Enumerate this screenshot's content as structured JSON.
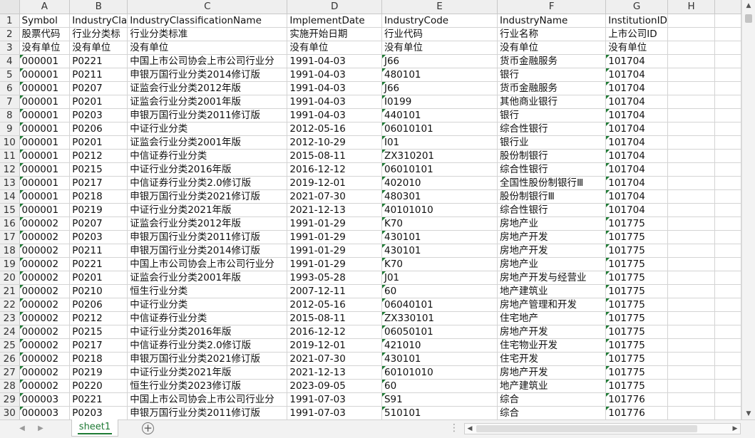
{
  "columns": [
    "A",
    "B",
    "C",
    "D",
    "E",
    "F",
    "G",
    "H"
  ],
  "rows": [
    [
      "Symbol",
      "IndustryCla",
      "IndustryClassificationName",
      "ImplementDate",
      "IndustryCode",
      "IndustryName",
      "InstitutionID",
      ""
    ],
    [
      "股票代码",
      "行业分类标",
      "行业分类标准",
      "实施开始日期",
      "行业代码",
      "行业名称",
      "上市公司ID",
      ""
    ],
    [
      "没有单位",
      "没有单位",
      "没有单位",
      "没有单位",
      "没有单位",
      "没有单位",
      "没有单位",
      ""
    ],
    [
      "000001",
      "P0221",
      "中国上市公司协会上市公司行业分",
      "1991-04-03",
      "J66",
      "货币金融服务",
      "101704",
      ""
    ],
    [
      "000001",
      "P0211",
      "申银万国行业分类2014修订版",
      "1991-04-03",
      "480101",
      "银行",
      "101704",
      ""
    ],
    [
      "000001",
      "P0207",
      "证监会行业分类2012年版",
      "1991-04-03",
      "J66",
      "货币金融服务",
      "101704",
      ""
    ],
    [
      "000001",
      "P0201",
      "证监会行业分类2001年版",
      "1991-04-03",
      "I0199",
      "其他商业银行",
      "101704",
      ""
    ],
    [
      "000001",
      "P0203",
      "申银万国行业分类2011修订版",
      "1991-04-03",
      "440101",
      "银行",
      "101704",
      ""
    ],
    [
      "000001",
      "P0206",
      "中证行业分类",
      "2012-05-16",
      "06010101",
      "综合性银行",
      "101704",
      ""
    ],
    [
      "000001",
      "P0201",
      "证监会行业分类2001年版",
      "2012-10-29",
      "I01",
      "银行业",
      "101704",
      ""
    ],
    [
      "000001",
      "P0212",
      "中信证券行业分类",
      "2015-08-11",
      "ZX310201",
      "股份制银行",
      "101704",
      ""
    ],
    [
      "000001",
      "P0215",
      "中证行业分类2016年版",
      "2016-12-12",
      "06010101",
      "综合性银行",
      "101704",
      ""
    ],
    [
      "000001",
      "P0217",
      "中信证券行业分类2.0修订版",
      "2019-12-01",
      "402010",
      "全国性股份制银行Ⅲ",
      "101704",
      ""
    ],
    [
      "000001",
      "P0218",
      "申银万国行业分类2021修订版",
      "2021-07-30",
      "480301",
      "股份制银行Ⅲ",
      "101704",
      ""
    ],
    [
      "000001",
      "P0219",
      "中证行业分类2021年版",
      "2021-12-13",
      "40101010",
      "综合性银行",
      "101704",
      ""
    ],
    [
      "000002",
      "P0207",
      "证监会行业分类2012年版",
      "1991-01-29",
      "K70",
      "房地产业",
      "101775",
      ""
    ],
    [
      "000002",
      "P0203",
      "申银万国行业分类2011修订版",
      "1991-01-29",
      "430101",
      "房地产开发",
      "101775",
      ""
    ],
    [
      "000002",
      "P0211",
      "申银万国行业分类2014修订版",
      "1991-01-29",
      "430101",
      "房地产开发",
      "101775",
      ""
    ],
    [
      "000002",
      "P0221",
      "中国上市公司协会上市公司行业分",
      "1991-01-29",
      "K70",
      "房地产业",
      "101775",
      ""
    ],
    [
      "000002",
      "P0201",
      "证监会行业分类2001年版",
      "1993-05-28",
      "J01",
      "房地产开发与经营业",
      "101775",
      ""
    ],
    [
      "000002",
      "P0210",
      "恒生行业分类",
      "2007-12-11",
      "60",
      "地产建筑业",
      "101775",
      ""
    ],
    [
      "000002",
      "P0206",
      "中证行业分类",
      "2012-05-16",
      "06040101",
      "房地产管理和开发",
      "101775",
      ""
    ],
    [
      "000002",
      "P0212",
      "中信证券行业分类",
      "2015-08-11",
      "ZX330101",
      "住宅地产",
      "101775",
      ""
    ],
    [
      "000002",
      "P0215",
      "中证行业分类2016年版",
      "2016-12-12",
      "06050101",
      "房地产开发",
      "101775",
      ""
    ],
    [
      "000002",
      "P0217",
      "中信证券行业分类2.0修订版",
      "2019-12-01",
      "421010",
      "住宅物业开发",
      "101775",
      ""
    ],
    [
      "000002",
      "P0218",
      "申银万国行业分类2021修订版",
      "2021-07-30",
      "430101",
      "住宅开发",
      "101775",
      ""
    ],
    [
      "000002",
      "P0219",
      "中证行业分类2021年版",
      "2021-12-13",
      "60101010",
      "房地产开发",
      "101775",
      ""
    ],
    [
      "000002",
      "P0220",
      "恒生行业分类2023修订版",
      "2023-09-05",
      "60",
      "地产建筑业",
      "101775",
      ""
    ],
    [
      "000003",
      "P0221",
      "中国上市公司协会上市公司行业分",
      "1991-07-03",
      "S91",
      "综合",
      "101776",
      ""
    ],
    [
      "000003",
      "P0203",
      "申银万国行业分类2011修订版",
      "1991-07-03",
      "510101",
      "综合",
      "101776",
      ""
    ]
  ],
  "sheet_tab": "sheet1",
  "add_sheet": "⊕",
  "more_dots": "⋮",
  "colors": {
    "accent": "#1e7a34",
    "header_bg": "#efefef",
    "grid": "#d4d4d4"
  }
}
